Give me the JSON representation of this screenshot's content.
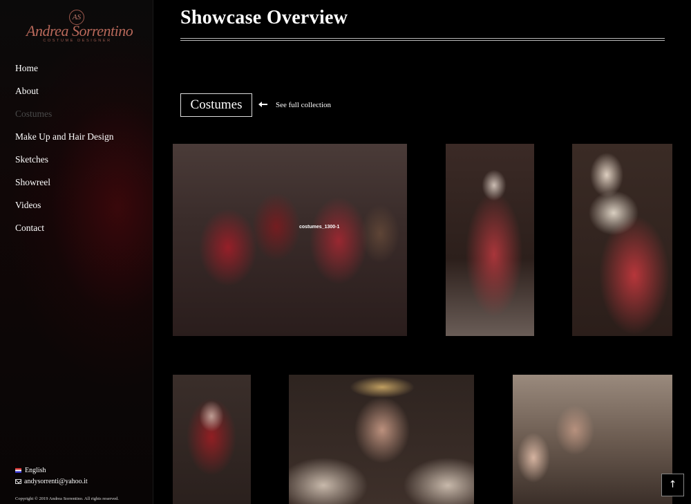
{
  "logo": {
    "monogram": "AS",
    "name": "Andrea Sorrentino",
    "subtitle": "COSTUME DESIGNER"
  },
  "nav": {
    "items": [
      {
        "label": "Home"
      },
      {
        "label": "About"
      },
      {
        "label": "Costumes"
      },
      {
        "label": "Make Up and Hair Design"
      },
      {
        "label": "Sketches"
      },
      {
        "label": "Showreel"
      },
      {
        "label": "Videos"
      },
      {
        "label": "Contact"
      }
    ],
    "active": "Costumes"
  },
  "footer": {
    "language": "English",
    "email": "andysorrenti@yahoo.it",
    "copyright": "Copyright © 2019 Andrea Sorrentino. All rights reserved."
  },
  "main": {
    "title": "Showcase Overview",
    "section_title": "Costumes",
    "see_link": "See full collection",
    "hover_label": "costumes_1300-1",
    "back_to_top_icon": "up-arrow-icon"
  },
  "colors": {
    "background": "#000000",
    "accent": "#b8685a"
  }
}
